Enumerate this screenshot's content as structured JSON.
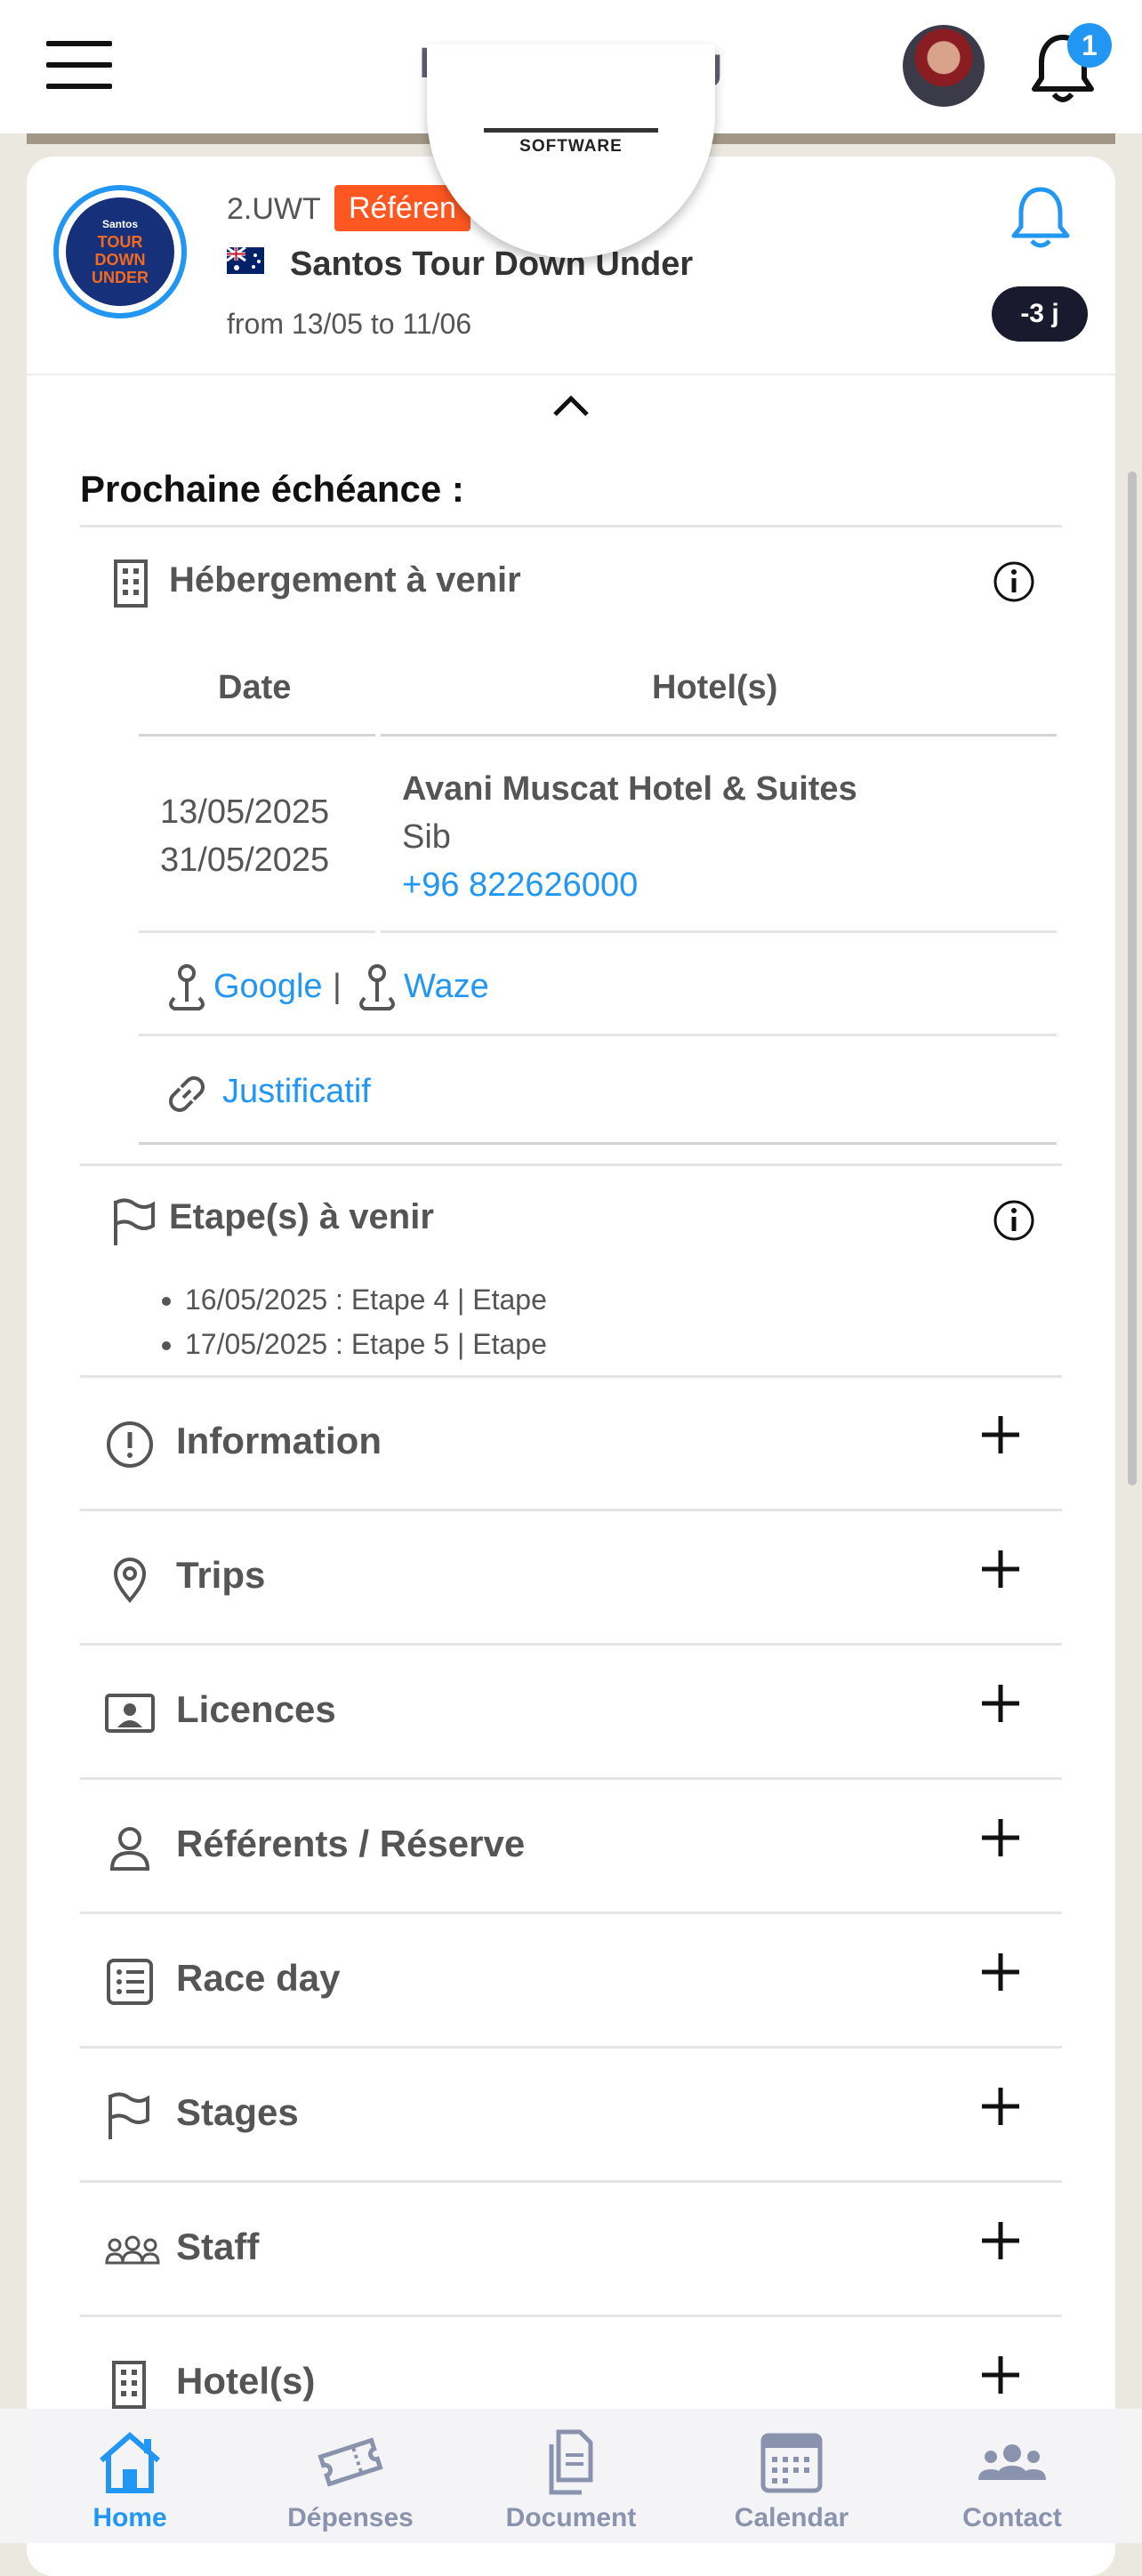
{
  "header": {
    "title": "Ipogee Cycling",
    "notification_count": "1",
    "logo_text": "SOFTWARE"
  },
  "event": {
    "category": "2.UWT",
    "tag": "Référen",
    "name": "Santos Tour Down Under",
    "dates": "from 13/05 to 11/06",
    "countdown": "-3 j",
    "logo_lines": [
      "Santos",
      "TOUR",
      "DOWN",
      "UNDER"
    ]
  },
  "next": {
    "title": "Prochaine échéance :",
    "accommodation": {
      "title": "Hébergement à venir",
      "col_date": "Date",
      "col_hotel": "Hotel(s)",
      "date_from": "13/05/2025",
      "date_to": "31/05/2025",
      "hotel_name": "Avani Muscat Hotel & Suites",
      "hotel_city": "Sib",
      "hotel_phone": "+96 822626000",
      "google": "Google",
      "separator": "|",
      "waze": "Waze",
      "proof": "Justificatif"
    },
    "stages": {
      "title": "Etape(s) à venir",
      "items": [
        "16/05/2025 : Etape 4 | Etape",
        "17/05/2025 : Etape 5 | Etape"
      ]
    }
  },
  "sections": [
    {
      "label": "Information",
      "icon": "exclamation-circle-icon"
    },
    {
      "label": "Trips",
      "icon": "location-pin-icon"
    },
    {
      "label": "Licences",
      "icon": "id-card-icon"
    },
    {
      "label": "Référents / Réserve",
      "icon": "user-icon"
    },
    {
      "label": "Race day",
      "icon": "checklist-icon"
    },
    {
      "label": "Stages",
      "icon": "flag-icon"
    },
    {
      "label": "Staff",
      "icon": "group-icon"
    },
    {
      "label": "Hotel(s)",
      "icon": "building-icon"
    }
  ],
  "nav": [
    {
      "label": "Home",
      "icon": "home-icon"
    },
    {
      "label": "Dépenses",
      "icon": "ticket-icon"
    },
    {
      "label": "Document",
      "icon": "documents-icon"
    },
    {
      "label": "Calendar",
      "icon": "calendar-icon"
    },
    {
      "label": "Contact",
      "icon": "contacts-icon"
    }
  ],
  "colors": {
    "accent": "#2196f3",
    "tag": "#ff5722",
    "countdown_bg": "#1a1a2e",
    "title": "#5e6272"
  }
}
